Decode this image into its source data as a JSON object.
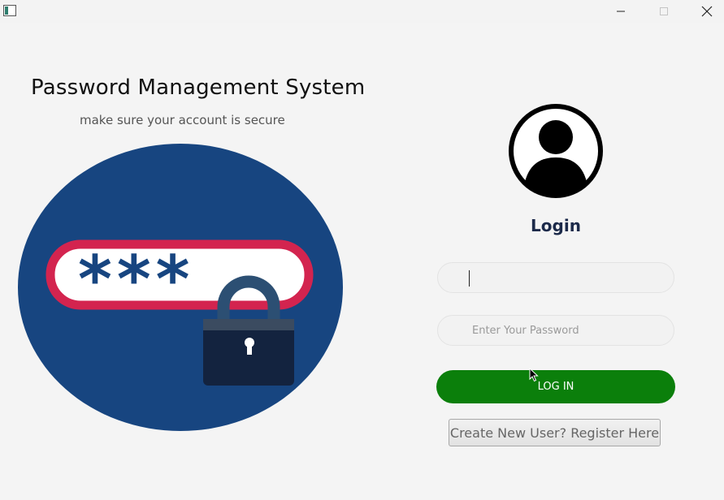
{
  "window": {
    "minimize_icon": "minimize-icon",
    "maximize_icon": "maximize-icon",
    "close_icon": "close-icon"
  },
  "header": {
    "title": "Password Management System",
    "subtitle": "make sure your account is secure"
  },
  "illustration": {
    "masked_text": "***",
    "colors": {
      "circle": "#174580",
      "pill_border": "#d3244f",
      "lock": "#13233f"
    }
  },
  "login": {
    "title": "Login",
    "username": {
      "value": "",
      "placeholder": ""
    },
    "password": {
      "value": "",
      "placeholder": "Enter Your Password"
    },
    "login_button": "LOG IN",
    "register_button": "Create New User? Register Here"
  },
  "colors": {
    "login_button": "#0b7f0b",
    "login_title": "#1c2a4a"
  }
}
